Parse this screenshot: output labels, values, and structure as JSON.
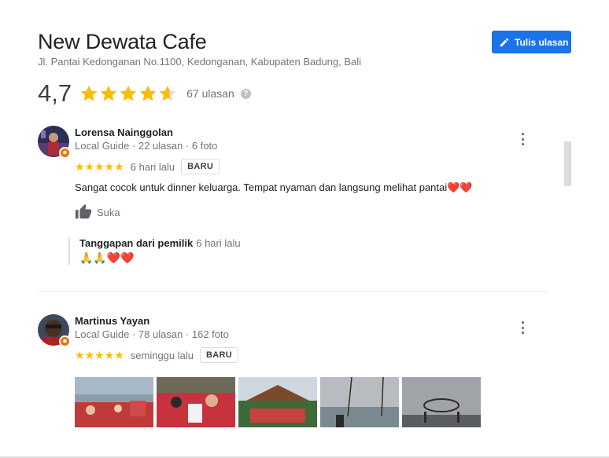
{
  "place": {
    "name": "New Dewata Cafe",
    "address": "Jl. Pantai Kedonganan No.1100, Kedonganan, Kabupaten Badung, Bali",
    "write_review_label": "Tulis ulasan",
    "rating": "4,7",
    "rating_value": 4.7,
    "review_count": "67 ulasan",
    "help_glyph": "?"
  },
  "colors": {
    "accent": "#1a73e8",
    "star": "#fbbc04",
    "guide_badge": "#e8710a"
  },
  "reviews": [
    {
      "name": "Lorensa Nainggolan",
      "meta": "Local Guide · 22 ulasan · 6 foto",
      "stars": "★★★★★",
      "rating": 5,
      "time": "6 hari lalu",
      "badge": "BARU",
      "text": "Sangat cocok untuk dinner keluarga. Tempat nyaman dan langsung melihat pantai❤️❤️",
      "like_label": "Suka",
      "owner_reply": {
        "heading": "Tanggapan dari pemilik",
        "time": "6 hari lalu",
        "text": "🙏🙏❤️❤️"
      }
    },
    {
      "name": "Martinus Yayan",
      "meta": "Local Guide · 78 ulasan · 162 foto",
      "stars": "★★★★★",
      "rating": 5,
      "time": "seminggu lalu",
      "badge": "BARU",
      "photos": [
        "photo-1",
        "photo-2",
        "photo-3",
        "photo-4",
        "photo-5"
      ]
    }
  ],
  "icons": {
    "write": "pencil-icon",
    "more": "more-vert-icon",
    "like": "thumb-up-icon",
    "help": "help-icon"
  }
}
